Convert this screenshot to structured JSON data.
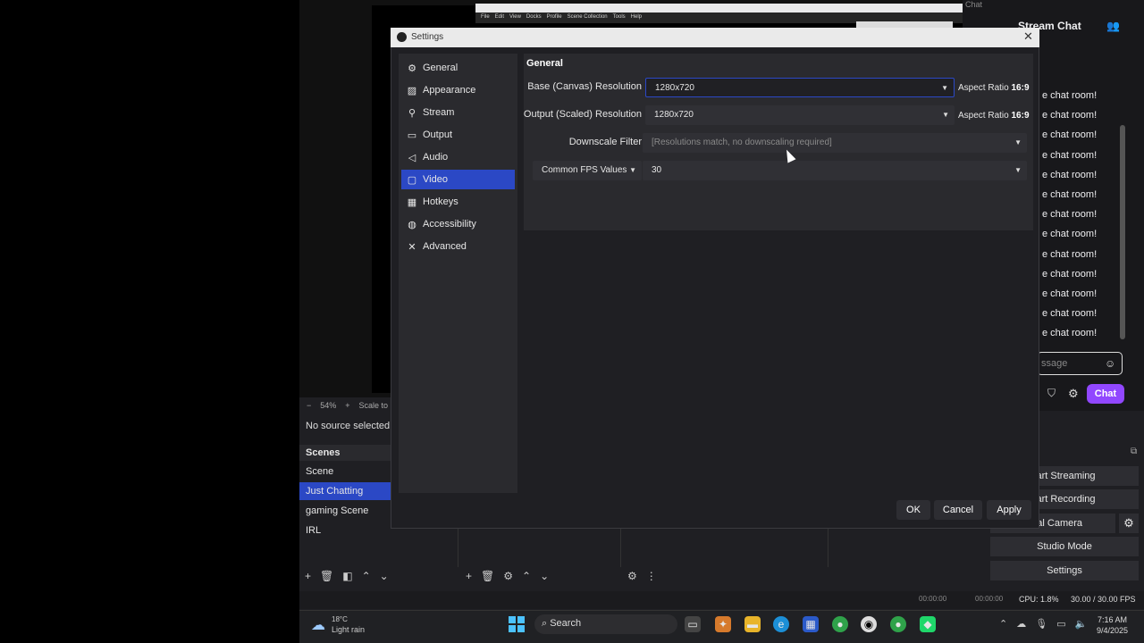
{
  "background_app": {
    "preview": {
      "zoom": "54%",
      "zoom_minus": "−",
      "zoom_plus": "+",
      "scale_label": "Scale to",
      "mini_menu": [
        "File",
        "Edit",
        "View",
        "Docks",
        "Profile",
        "Scene Collection",
        "Tools",
        "Help"
      ]
    },
    "no_source": "No source selected",
    "scenes": {
      "title": "Scenes",
      "items": [
        "Scene",
        "Just Chatting",
        "gaming Scene",
        "IRL"
      ],
      "selected": "Just Chatting"
    },
    "chat": {
      "tab": "Chat",
      "title": "Stream Chat",
      "message": "e chat room!",
      "message_count": 13,
      "input_placeholder": "ssage",
      "send_label": "Chat"
    },
    "controls": {
      "start_streaming": "tart Streaming",
      "start_recording": "tart Recording",
      "virtual_camera": "irtual Camera",
      "studio_mode": "Studio Mode",
      "settings": "Settings"
    },
    "status": {
      "time1": "00:00:00",
      "time2": "00:00:00",
      "cpu": "CPU: 1.8%",
      "fps": "30.00 / 30.00 FPS"
    }
  },
  "taskbar": {
    "weather_temp": "18°C",
    "weather_cond": "Light rain",
    "search_label": "Search",
    "clock_time": "7:16 AM",
    "clock_date": "9/4/2025"
  },
  "settings": {
    "title": "Settings",
    "nav": [
      {
        "label": "General",
        "icon": "gear-icon"
      },
      {
        "label": "Appearance",
        "icon": "palette-icon"
      },
      {
        "label": "Stream",
        "icon": "antenna-icon"
      },
      {
        "label": "Output",
        "icon": "monitor-icon"
      },
      {
        "label": "Audio",
        "icon": "speaker-icon"
      },
      {
        "label": "Video",
        "icon": "display-icon"
      },
      {
        "label": "Hotkeys",
        "icon": "keyboard-icon"
      },
      {
        "label": "Accessibility",
        "icon": "accessibility-icon"
      },
      {
        "label": "Advanced",
        "icon": "wrench-icon"
      }
    ],
    "selected_nav": "Video",
    "section_title": "General",
    "rows": {
      "base_label": "Base (Canvas) Resolution",
      "base_value": "1280x720",
      "base_aspect_prefix": "Aspect Ratio",
      "base_aspect": "16:9",
      "output_label": "Output (Scaled) Resolution",
      "output_value": "1280x720",
      "output_aspect_prefix": "Aspect Ratio",
      "output_aspect": "16:9",
      "downscale_label": "Downscale Filter",
      "downscale_value": "[Resolutions match, no downscaling required]",
      "fps_type": "Common FPS Values",
      "fps_value": "30"
    },
    "buttons": {
      "ok": "OK",
      "cancel": "Cancel",
      "apply": "Apply"
    }
  }
}
